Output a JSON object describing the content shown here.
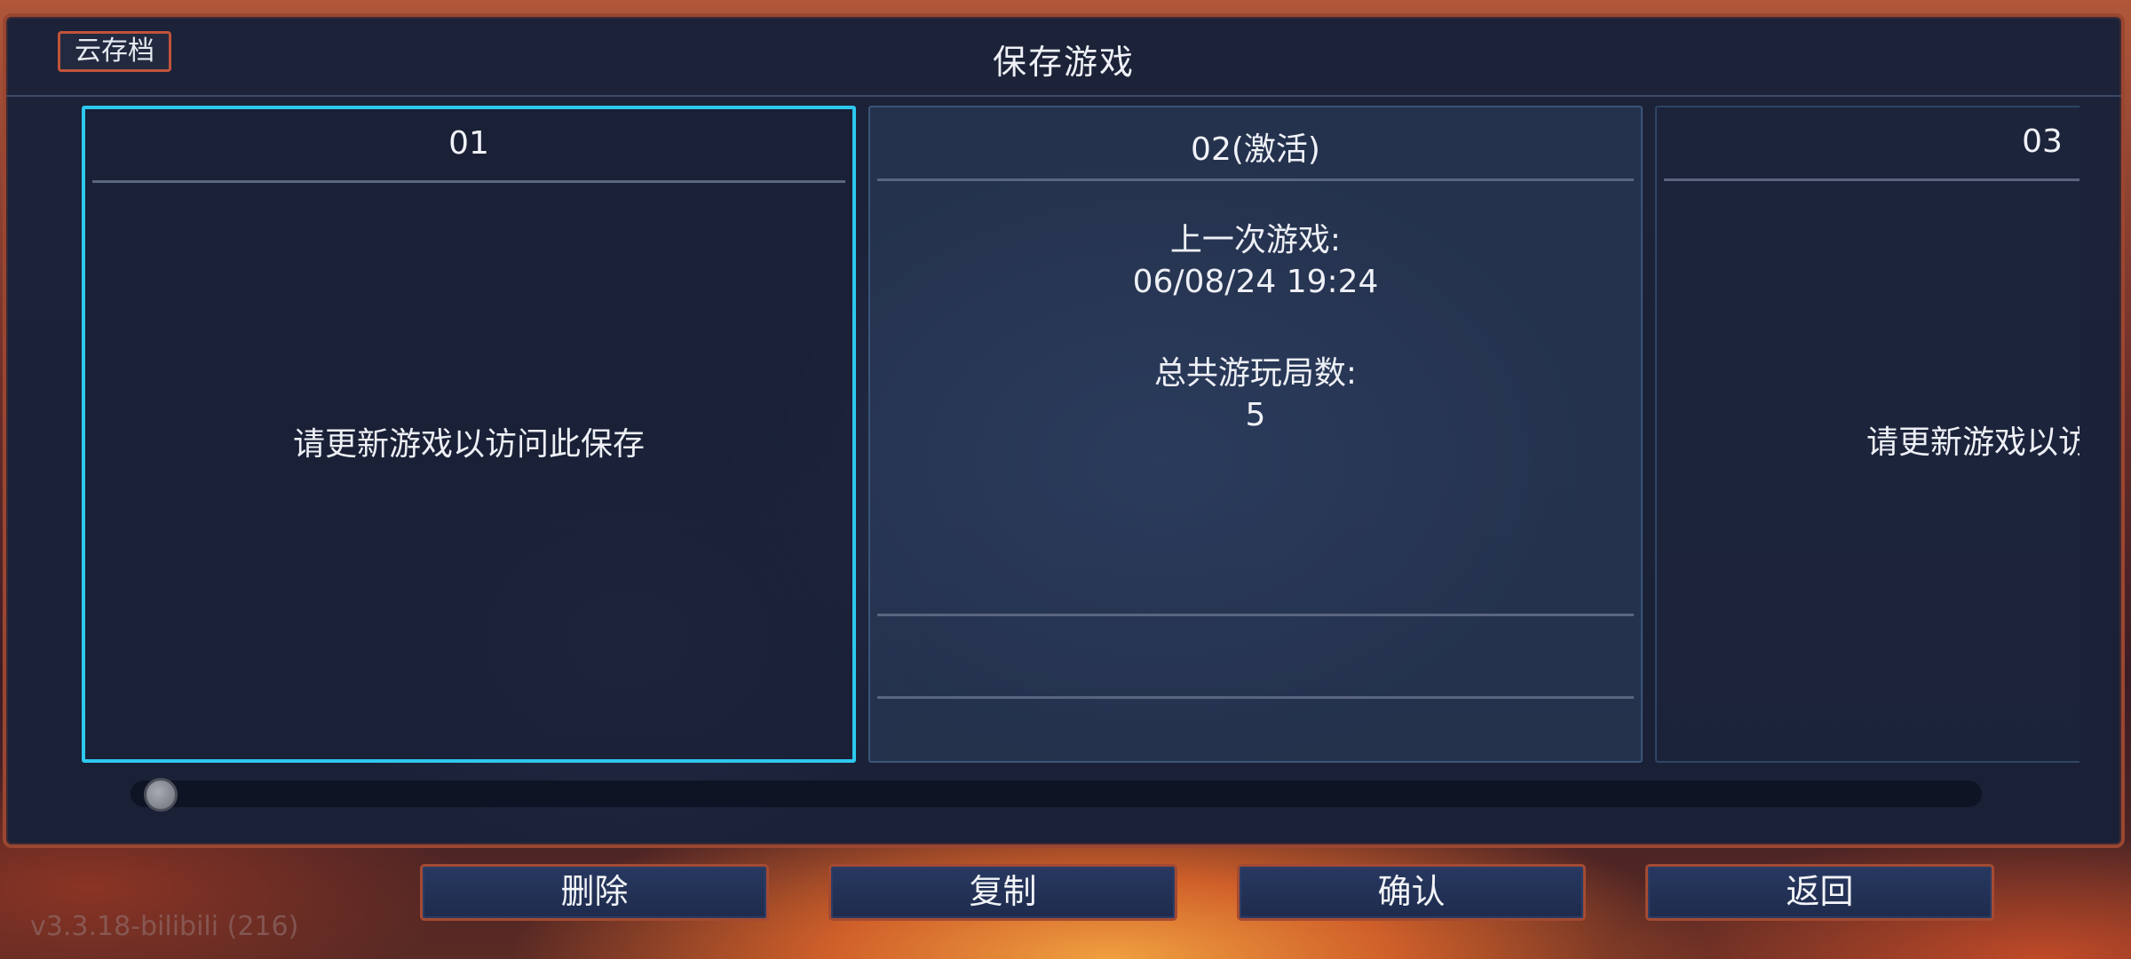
{
  "header": {
    "cloud_button_label": "云存档",
    "title": "保存游戏"
  },
  "slots": [
    {
      "title": "01",
      "message": "请更新游戏以访问此保存"
    },
    {
      "title": "02(激活)",
      "last_played_label": "上一次游戏:",
      "last_played_value": "06/08/24 19:24",
      "total_runs_label": "总共游玩局数:",
      "total_runs_value": "5"
    },
    {
      "title": "03",
      "message": "请更新游戏以访问此保存"
    }
  ],
  "scrollbar": {
    "position": 0.0
  },
  "buttons": {
    "delete": "删除",
    "copy": "复制",
    "confirm": "确认",
    "back": "返回"
  },
  "footer": {
    "version": "v3.3.18-bilibili (216)"
  },
  "colors": {
    "selected_border": "#2ec8ee",
    "frame_accent": "#9a4630",
    "panel_bg": "#1b2238"
  }
}
